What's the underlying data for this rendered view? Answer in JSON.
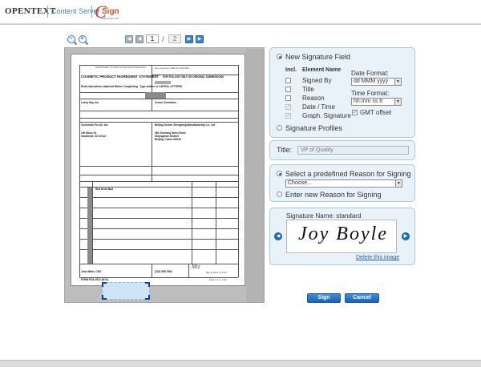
{
  "header": {
    "brand": "OPENTEXT",
    "product": "Content Server",
    "logo_text": "Sign",
    "logo_subtitle": "Digital Approvals"
  },
  "viewer": {
    "page_current": "1",
    "page_separator": "/",
    "page_total": "2"
  },
  "document": {
    "agency": "DEPARTMENT OF HEALTH AND HUMAN SERVICES",
    "title": "COSMETIC PRODUCT INGREDIENT STATEMENT",
    "approval": "Form Approved: OMB No. 0910-0030",
    "fda_use": "FOR FDA USE ONLY ON ORIGINAL SUBMISSIONS",
    "instructions": "Read Instructions Attached Before Completing - Type written or CAPITAL LETTERS",
    "firm_name": "Lucky Day, Inc.",
    "product_name": "Crown Cosmetics",
    "manufacturer": "Cosmetics For All, Inc.",
    "manufacturer_addr1": "100 Moon St.",
    "manufacturer_addr2": "Goodtrekt, XX 22112",
    "packer": "Beijing Jinwen Zhengtong Manufacturing Co., Ltd",
    "packer_addr1": "369 Jinsheng West Street",
    "packer_addr2": "Shijingshan District",
    "packer_addr3": "Beijing, China 100043",
    "ingredient": "Red Dried Bud",
    "signer": "John Miller, CEO",
    "phone": "(222) 555-7654",
    "stamp": "May 22 2013 3:13 PM",
    "footer_form": "FORM FDA 2512 (8/13)",
    "footer_page": "Page 1 of 2 - Intact"
  },
  "signature_field": {
    "new_label": "New Signature Field",
    "col_incl": "Incl.",
    "col_element": "Element Name",
    "elements": [
      {
        "label": "Signed By",
        "checked": false,
        "disabled": false
      },
      {
        "label": "Title",
        "checked": false,
        "disabled": false
      },
      {
        "label": "Reason",
        "checked": false,
        "disabled": false
      },
      {
        "label": "Date / Time",
        "checked": true,
        "disabled": true
      },
      {
        "label": "Graph. Signature",
        "checked": true,
        "disabled": true
      }
    ],
    "date_format_label": "Date Format:",
    "date_format_value": "dd MMM yyyy",
    "time_format_label": "Time Format:",
    "time_format_value": "hh:mm ss tt",
    "gmt_label": "GMT offset",
    "gmt_checked": true,
    "profiles_label": "Signature Profiles"
  },
  "title_field": {
    "label": "Title:",
    "value": "VP of Quality"
  },
  "reason": {
    "predefined_label": "Select a predefined Reason for Signing",
    "choose_value": "Choose...",
    "new_label": "Enter new Reason for Signing"
  },
  "signature": {
    "name_label": "Signature Name: standard",
    "image_text": "Joy Boyle",
    "delete_link": "Delete this image"
  },
  "buttons": {
    "sign": "Sign",
    "cancel": "Cancel"
  },
  "colors": {
    "accent": "#1f62b0",
    "panel_bg": "#e9f2f8",
    "panel_border": "#a9c8dc",
    "link": "#1d5fb4"
  }
}
